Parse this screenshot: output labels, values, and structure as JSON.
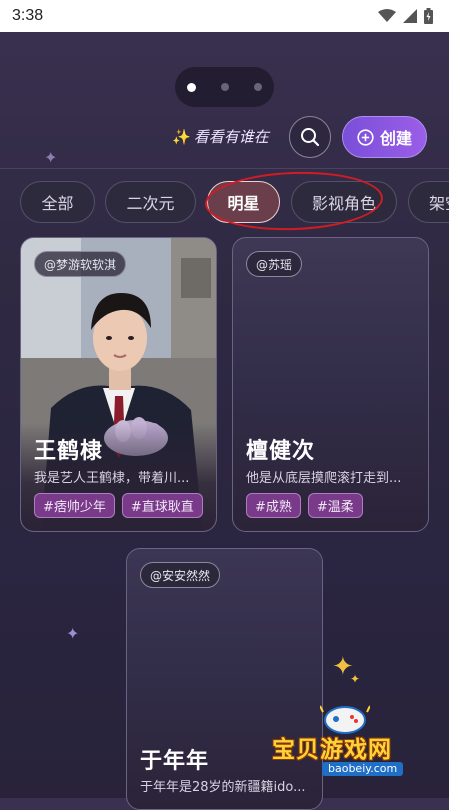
{
  "status_bar": {
    "time": "3:38"
  },
  "header": {
    "who_is_here": "看看有谁在",
    "create_label": "创建"
  },
  "tabs": [
    {
      "label": "全部"
    },
    {
      "label": "二次元"
    },
    {
      "label": "明星"
    },
    {
      "label": "影视角色"
    },
    {
      "label": "架空"
    }
  ],
  "active_tab": "明星",
  "cards": [
    {
      "author": "@梦游软软淇",
      "title": "王鹤棣",
      "desc": "我是艺人王鹤棣，带着川...",
      "tags": [
        "#痞帅少年",
        "#直球耿直"
      ]
    },
    {
      "author": "@苏瑶",
      "title": "檀健次",
      "desc": "他是从底层摸爬滚打走到...",
      "tags": [
        "#成熟",
        "#温柔"
      ]
    },
    {
      "author": "@安安然然",
      "title": "于年年",
      "desc": "于年年是28岁的新疆籍ido..."
    }
  ],
  "watermark": {
    "text": "宝贝游戏网",
    "url": "baobeiy.com"
  },
  "colors": {
    "accent": "#8b57e3",
    "tag": "#7a3a8a",
    "annotation": "#d11c24"
  }
}
